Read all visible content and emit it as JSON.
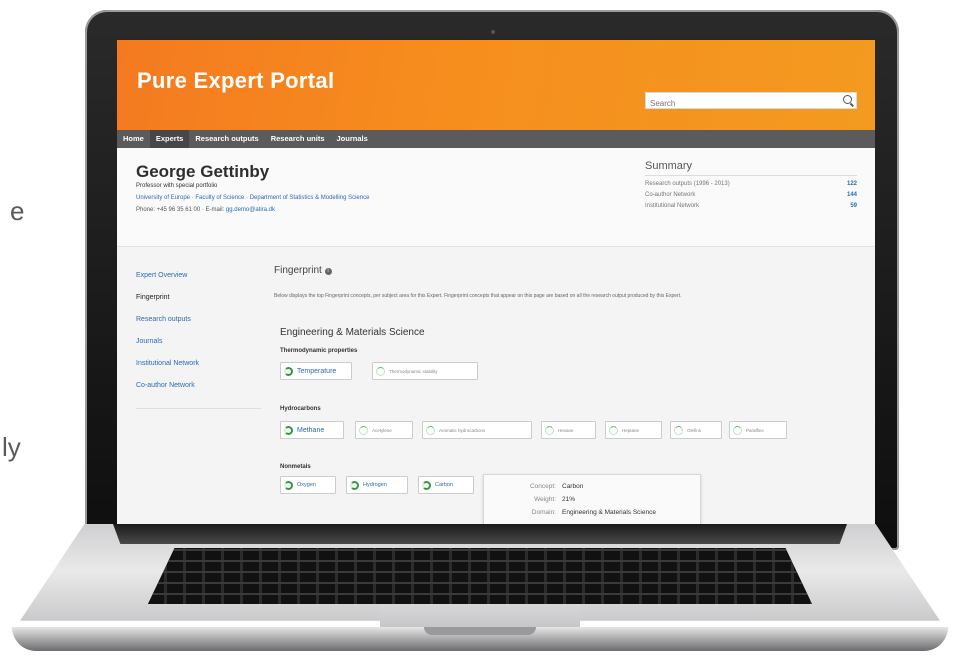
{
  "side_text": {
    "fragment_1": "e",
    "fragment_2": "ly"
  },
  "portal": {
    "title": "Pure Expert Portal",
    "search_placeholder": "Search",
    "nav": [
      "Home",
      "Experts",
      "Research outputs",
      "Research units",
      "Journals"
    ]
  },
  "profile": {
    "name": "George Gettinby",
    "role": "Professor with special portfolio",
    "affiliation": "University of Europe  ·  Faculty of Science  ·  Department of Statistics & Modelling Science",
    "phone": "Phone: +45 96 35 61 00  ·  E-mail: ",
    "email": "gg.demo@atira.dk"
  },
  "summary": {
    "title": "Summary",
    "rows": [
      {
        "label": "Research outputs (1996 - 2013)",
        "count": "122"
      },
      {
        "label": "Co-author Network",
        "count": "144"
      },
      {
        "label": "Institutional Network",
        "count": "59"
      }
    ]
  },
  "leftnav": [
    "Expert Overview",
    "Fingerprint",
    "Research outputs",
    "Journals",
    "Institutional Network",
    "Co-author Network"
  ],
  "fingerprint": {
    "title": "Fingerprint",
    "description": "Below displays the top Fingerprint concepts, per subject area for this Expert. Fingerprint concepts that appear on this page are based on all the research output produced by this Expert.",
    "domain": "Engineering & Materials Science",
    "groups": [
      {
        "title": "Thermodynamic properties",
        "concepts": [
          "Temperature",
          "Thermodynamic stability"
        ]
      },
      {
        "title": "Hydrocarbons",
        "concepts": [
          "Methane",
          "Acetylene",
          "Aromatic hydrocarbons",
          "Hexane",
          "Heptane",
          "Olefins",
          "Paraffins"
        ]
      },
      {
        "title": "Nonmetals",
        "concepts": [
          "Oxygen",
          "Hydrogen",
          "Carbon"
        ]
      }
    ]
  },
  "tooltip": {
    "concept_label": "Concept:",
    "concept_value": "Carbon",
    "weight_label": "Weight:",
    "weight_value": "21%",
    "domain_label": "Domain:",
    "domain_value": "Engineering & Materials Science"
  }
}
